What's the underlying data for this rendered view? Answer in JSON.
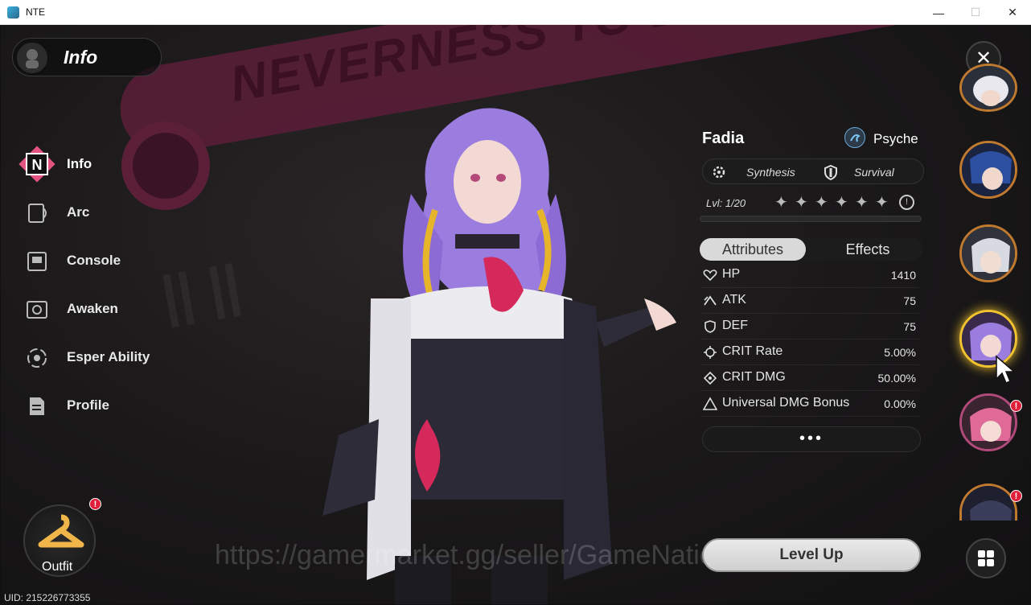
{
  "window": {
    "title": "NTE",
    "minimize": "—",
    "maximize": "☐",
    "close": "✕"
  },
  "background": {
    "banner_text": "NEVERNESS TO EVERNESS"
  },
  "header": {
    "title": "Info"
  },
  "nav": [
    {
      "label": "Info",
      "icon": "n-logo-icon",
      "active": true
    },
    {
      "label": "Arc",
      "icon": "arc-icon"
    },
    {
      "label": "Console",
      "icon": "console-icon"
    },
    {
      "label": "Awaken",
      "icon": "awaken-icon"
    },
    {
      "label": "Esper Ability",
      "icon": "esper-swirl-icon"
    },
    {
      "label": "Profile",
      "icon": "profile-document-icon"
    }
  ],
  "outfit": {
    "label": "Outfit",
    "badge": "!"
  },
  "uid": "UID: 215226773355",
  "character": {
    "name": "Fadia",
    "element": "Psyche",
    "roles": [
      "Synthesis",
      "Survival"
    ],
    "level": "Lvl: 1/20",
    "stars": 6
  },
  "tabs": {
    "active": "Attributes",
    "inactive": "Effects"
  },
  "attributes": [
    {
      "label": "HP",
      "value": "1410",
      "icon": "heart-icon"
    },
    {
      "label": "ATK",
      "value": "75",
      "icon": "atk-icon"
    },
    {
      "label": "DEF",
      "value": "75",
      "icon": "shield-icon"
    },
    {
      "label": "CRIT Rate",
      "value": "5.00%",
      "icon": "crosshair-icon"
    },
    {
      "label": "CRIT DMG",
      "value": "50.00%",
      "icon": "crosshair-icon"
    },
    {
      "label": "Universal DMG Bonus",
      "value": "0.00%",
      "icon": "triangle-icon"
    }
  ],
  "more_label": "•••",
  "level_up_label": "Level Up",
  "watermark": "https://gamermarket.gg/seller/GameNation",
  "colors": {
    "accent": "#f2c330",
    "banner": "#5c1f38",
    "badge": "#e0203a",
    "hair": "#9b7de0"
  }
}
